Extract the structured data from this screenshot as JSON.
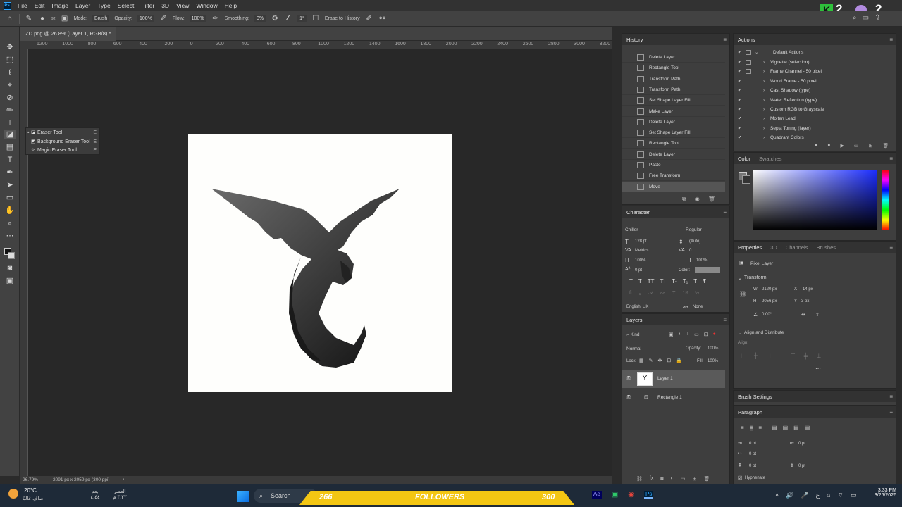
{
  "app": {
    "logo": "Ps",
    "menu": [
      "File",
      "Edit",
      "Image",
      "Layer",
      "Type",
      "Select",
      "Filter",
      "3D",
      "View",
      "Window",
      "Help"
    ]
  },
  "options": {
    "brush_size": "92",
    "mode_label": "Mode:",
    "mode_value": "Brush",
    "opacity_label": "Opacity:",
    "opacity_value": "100%",
    "flow_label": "Flow:",
    "flow_value": "100%",
    "smoothing_label": "Smoothing:",
    "smoothing_value": "0%",
    "angle_value": "1°",
    "erase_history": "Erase to History"
  },
  "document": {
    "tab_title": "ZD.png @ 26.8% (Layer 1, RGB/8) *",
    "zoom": "26.79%",
    "size_info": "2091 px x 2059 px (300 ppi)"
  },
  "ruler": {
    "h_ticks": [
      "1200",
      "1000",
      "800",
      "600",
      "400",
      "200",
      "0",
      "200",
      "400",
      "600",
      "800",
      "1000",
      "1200",
      "1400",
      "1600",
      "1800",
      "2000",
      "2200",
      "2400",
      "2600",
      "2800",
      "3000",
      "3200"
    ]
  },
  "flyout": {
    "items": [
      {
        "label": "Eraser Tool",
        "key": "E"
      },
      {
        "label": "Background Eraser Tool",
        "key": "E"
      },
      {
        "label": "Magic Eraser Tool",
        "key": "E"
      }
    ]
  },
  "history": {
    "title": "History",
    "items": [
      "Delete Layer",
      "Rectangle Tool",
      "Transform Path",
      "Transform Path",
      "Set Shape Layer Fill",
      "Make Layer",
      "Delete Layer",
      "Set Shape Layer Fill",
      "Rectangle Tool",
      "Delete Layer",
      "Paste",
      "Free Transform",
      "Move"
    ]
  },
  "actions": {
    "title": "Actions",
    "group": "Default Actions",
    "items": [
      "Vignette (selection)",
      "Frame Channel - 50 pixel",
      "Wood Frame - 50 pixel",
      "Cast Shadow (type)",
      "Water Reflection (type)",
      "Custom RGB to Grayscale",
      "Molten Lead",
      "Sepia Toning (layer)",
      "Quadrant Colors"
    ]
  },
  "color": {
    "tab1": "Color",
    "tab2": "Swatches"
  },
  "character": {
    "title": "Character",
    "font": "Chiller",
    "style": "Regular",
    "size": "128 pt",
    "leading": "(Auto)",
    "kerning": "Metrics",
    "tracking": "0",
    "vscale": "100%",
    "hscale": "100%",
    "baseline": "0 pt",
    "color_label": "Color:",
    "language": "English: UK",
    "aa": "None"
  },
  "properties": {
    "tabs": [
      "Properties",
      "3D",
      "Channels",
      "Brushes"
    ],
    "kind": "Pixel Layer",
    "transform": "Transform",
    "w": "2120 px",
    "x": "-14 px",
    "h": "2056 px",
    "y": "3 px",
    "angle": "0.00°",
    "align": "Align and Distribute",
    "align_sub": "Align:"
  },
  "layers": {
    "title": "Layers",
    "filter": "Kind",
    "blend": "Normal",
    "opacity_label": "Opacity:",
    "opacity": "100%",
    "lock_label": "Lock:",
    "fill_label": "Fill:",
    "fill": "100%",
    "items": [
      "Layer 1",
      "Rectangle 1"
    ]
  },
  "brush_settings": {
    "title": "Brush Settings"
  },
  "paragraph": {
    "title": "Paragraph",
    "v1": "0 pt",
    "v2": "0 pt",
    "v3": "0 pt",
    "v4": "0 pt",
    "v5": "0 pt",
    "hyphenate": "Hyphenate"
  },
  "taskbar": {
    "temp": "20°C",
    "weather": "صافٍ غالبًا",
    "search": "Search",
    "followers_left": "266",
    "followers": "FOLLOWERS",
    "followers_right": "300",
    "ar1": "بعد",
    "ar2": "٤:٤٤",
    "ar3": "العصر",
    "ar4": "٣:٣٣ م",
    "ar5": "ع",
    "time": "3:33 PM",
    "date": "3/26/2026"
  },
  "overlay": {
    "k_count_1": "2",
    "k_count_2": "2"
  }
}
